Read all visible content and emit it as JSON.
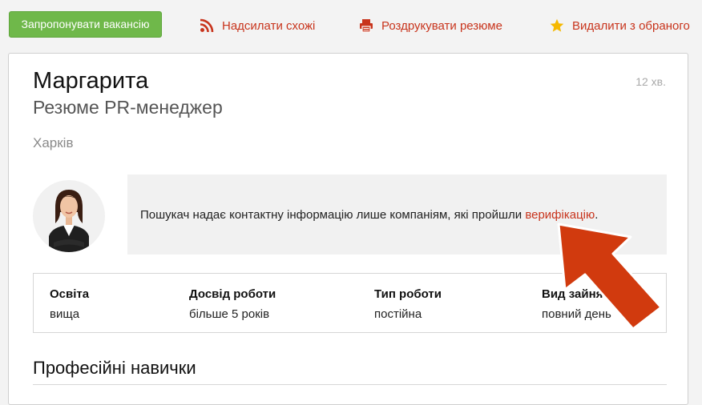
{
  "toolbar": {
    "propose_label": "Запропонувати вакансію",
    "similar_label": "Надсилати схожі",
    "print_label": "Роздрукувати резюме",
    "favorite_label": "Видалити з обраного"
  },
  "resume": {
    "name": "Маргарита",
    "time": "12 хв.",
    "title": "Резюме PR-менеджер",
    "city": "Харків"
  },
  "notice": {
    "text": "Пошукач надає контактну інформацію лише компаніям, які пройшли ",
    "link": "верифікацію",
    "end": "."
  },
  "info": [
    {
      "label": "Освіта",
      "value": "вища"
    },
    {
      "label": "Досвід роботи",
      "value": "більше 5 років"
    },
    {
      "label": "Тип роботи",
      "value": "постійна"
    },
    {
      "label": "Вид зайнятості",
      "value": "повний день"
    }
  ],
  "sections": {
    "skills_heading": "Професійні навички"
  },
  "colors": {
    "accent": "#c8341c",
    "button_green": "#6fb84a",
    "star": "#f5b800",
    "arrow": "#d13a0e"
  }
}
